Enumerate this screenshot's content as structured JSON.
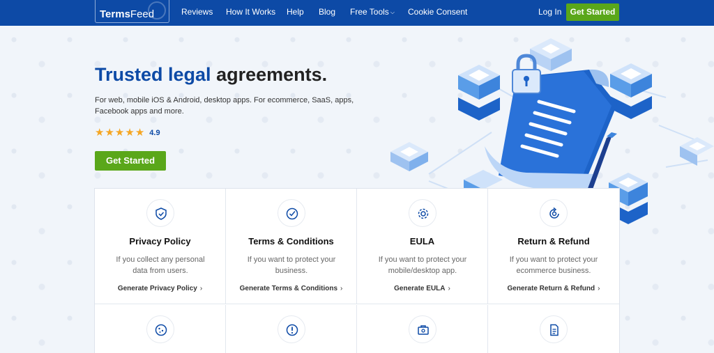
{
  "nav": {
    "logo_a": "Terms",
    "logo_b": "Feed",
    "links": [
      "Reviews",
      "How It Works",
      "Help",
      "Blog",
      "Free Tools",
      "Cookie Consent"
    ],
    "login": "Log In",
    "cta": "Get Started"
  },
  "hero": {
    "title_accent": "Trusted legal",
    "title_rest": " agreements.",
    "subtitle": "For web, mobile iOS & Android, desktop apps. For ecommerce, SaaS, apps, Facebook apps and more.",
    "rating": "4.9",
    "stars": 5,
    "cta": "Get Started"
  },
  "cards": [
    {
      "title": "Privacy Policy",
      "desc": "If you collect any personal data from users.",
      "link": "Generate Privacy Policy",
      "icon": "shield-check-icon"
    },
    {
      "title": "Terms & Conditions",
      "desc": "If you want to protect your business.",
      "link": "Generate Terms & Conditions",
      "icon": "check-circle-icon"
    },
    {
      "title": "EULA",
      "desc": "If you want to protect your mobile/desktop app.",
      "link": "Generate EULA",
      "icon": "gear-icon"
    },
    {
      "title": "Return & Refund",
      "desc": "If you want to protect your ecommerce business.",
      "link": "Generate Return & Refund",
      "icon": "refresh-icon"
    }
  ],
  "cards_row2": [
    {
      "icon": "cookie-icon"
    },
    {
      "icon": "alert-icon"
    },
    {
      "icon": "toolbox-icon"
    },
    {
      "icon": "document-icon"
    }
  ],
  "colors": {
    "brand": "#0d4aa6",
    "cta": "#5aa71a",
    "star": "#f5a623"
  }
}
